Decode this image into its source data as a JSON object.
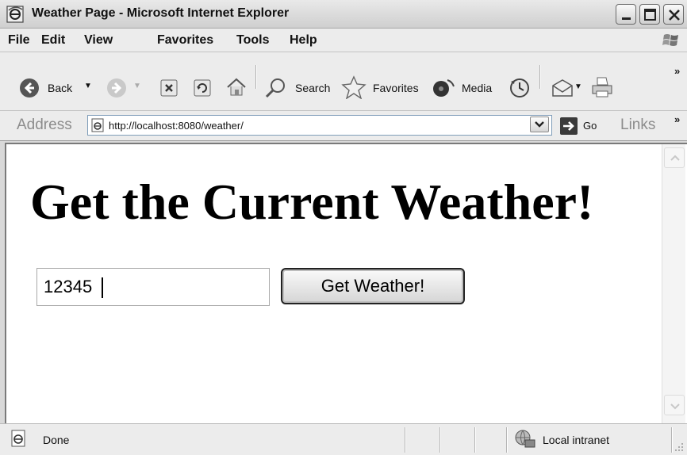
{
  "window": {
    "title": "Weather Page - Microsoft Internet Explorer"
  },
  "menu": [
    "File",
    "Edit",
    "View",
    "Favorites",
    "Tools",
    "Help"
  ],
  "toolbar": {
    "back_label": "Back",
    "search_label": "Search",
    "favorites_label": "Favorites",
    "media_label": "Media",
    "overflow": "»"
  },
  "address_bar": {
    "label": "Address",
    "url": "http://localhost:8080/weather/",
    "go_label": "Go",
    "links_label": "Links",
    "overflow": "»"
  },
  "page": {
    "heading": "Get the Current Weather!",
    "zip_value": "12345",
    "button_label": "Get Weather!"
  },
  "status_bar": {
    "text": "Done",
    "zone": "Local intranet"
  }
}
